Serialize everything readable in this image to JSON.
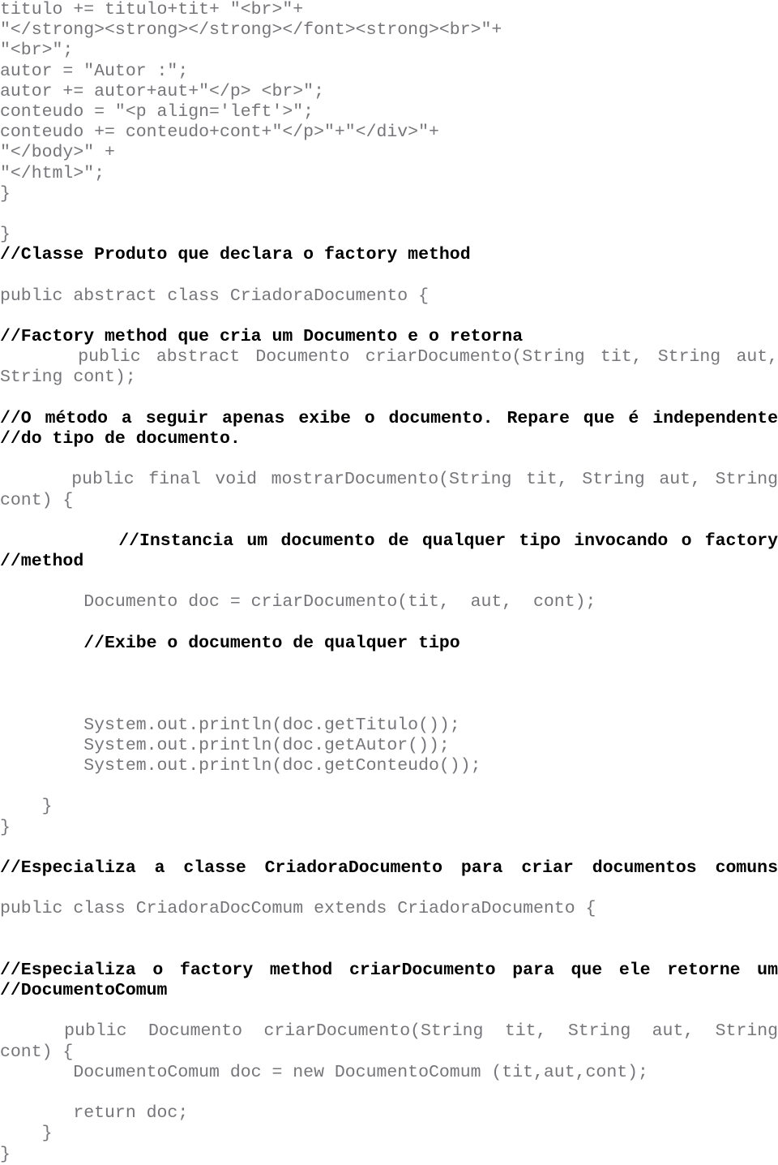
{
  "document": {
    "type": "source-code-listing",
    "language": "Java",
    "page_background": "#ffffff",
    "code_color": "#76767a",
    "comment_color": "#000000",
    "lines": [
      {
        "id": "l1",
        "text": "titulo += titulo+tit+ \"<br>\"+",
        "style": "code"
      },
      {
        "id": "l2",
        "text": "\"</strong><strong></strong></font><strong><br>\"+",
        "style": "code"
      },
      {
        "id": "l3",
        "text": "\"<br>\";",
        "style": "code"
      },
      {
        "id": "l4",
        "text": "autor = \"Autor :\";",
        "style": "code"
      },
      {
        "id": "l5",
        "text": "autor += autor+aut+\"</p> <br>\";",
        "style": "code"
      },
      {
        "id": "l6",
        "text": "conteudo = \"<p align='left'>\";",
        "style": "code"
      },
      {
        "id": "l7",
        "text": "conteudo += conteudo+cont+\"</p>\"+\"</div>\"+",
        "style": "code"
      },
      {
        "id": "l8",
        "text": "\"</body>\" +",
        "style": "code"
      },
      {
        "id": "l9",
        "text": "\"</html>\";",
        "style": "code"
      },
      {
        "id": "l10",
        "text": "}",
        "style": "code"
      },
      {
        "id": "l11",
        "text": "",
        "style": "blank"
      },
      {
        "id": "l12",
        "text": "}",
        "style": "code"
      },
      {
        "id": "l13",
        "text": "//Classe Produto que declara o factory method",
        "style": "comment"
      },
      {
        "id": "l14",
        "text": "",
        "style": "blank"
      },
      {
        "id": "l15",
        "text": "public abstract class CriadoraDocumento {",
        "style": "code"
      },
      {
        "id": "l16",
        "text": "",
        "style": "blank"
      },
      {
        "id": "l17",
        "text": "//Factory method que cria um Documento e o retorna",
        "style": "comment"
      },
      {
        "id": "l18",
        "text": "    public abstract Documento criarDocumento(String tit,  String aut,",
        "style": "code-justify"
      },
      {
        "id": "l19",
        "text": "String cont);",
        "style": "code"
      },
      {
        "id": "l20",
        "text": "",
        "style": "blank"
      },
      {
        "id": "l21",
        "text": "//O método a seguir apenas exibe o documento. Repare que é independente",
        "style": "comment-justify"
      },
      {
        "id": "l22",
        "text": "//do tipo de documento.",
        "style": "comment"
      },
      {
        "id": "l23",
        "text": "",
        "style": "blank"
      },
      {
        "id": "l24",
        "text": "    public final void mostrarDocumento(String tit,  String aut,  String",
        "style": "code-justify"
      },
      {
        "id": "l25",
        "text": "cont) {",
        "style": "code"
      },
      {
        "id": "l26",
        "text": "",
        "style": "blank"
      },
      {
        "id": "l27",
        "text": "        //Instancia um documento de qualquer tipo invocando o factory",
        "style": "comment-justify"
      },
      {
        "id": "l28",
        "text": "//method",
        "style": "comment"
      },
      {
        "id": "l29",
        "text": "",
        "style": "blank"
      },
      {
        "id": "l30",
        "text": "        Documento doc = criarDocumento(tit,  aut,  cont);",
        "style": "code"
      },
      {
        "id": "l31",
        "text": "",
        "style": "blank"
      },
      {
        "id": "l32",
        "text": "        //Exibe o documento de qualquer tipo",
        "style": "comment"
      },
      {
        "id": "l33",
        "text": "",
        "style": "blank"
      },
      {
        "id": "l34",
        "text": "",
        "style": "blank"
      },
      {
        "id": "l35",
        "text": "",
        "style": "blank"
      },
      {
        "id": "l36",
        "text": "        System.out.println(doc.getTitulo());",
        "style": "code"
      },
      {
        "id": "l37",
        "text": "        System.out.println(doc.getAutor());",
        "style": "code"
      },
      {
        "id": "l38",
        "text": "        System.out.println(doc.getConteudo());",
        "style": "code"
      },
      {
        "id": "l39",
        "text": "",
        "style": "blank"
      },
      {
        "id": "l40",
        "text": "    }",
        "style": "code"
      },
      {
        "id": "l41",
        "text": "}",
        "style": "code"
      },
      {
        "id": "l42",
        "text": "",
        "style": "blank"
      },
      {
        "id": "l43",
        "text": "//Especializa a classe CriadoraDocumento para criar documentos comuns",
        "style": "comment-justify"
      },
      {
        "id": "l44",
        "text": "",
        "style": "blank"
      },
      {
        "id": "l45",
        "text": "public class CriadoraDocComum extends CriadoraDocumento {",
        "style": "code"
      },
      {
        "id": "l46",
        "text": "",
        "style": "blank"
      },
      {
        "id": "l47",
        "text": "",
        "style": "blank"
      },
      {
        "id": "l48",
        "text": "//Especializa o factory method criarDocumento para que ele retorne um",
        "style": "comment-justify"
      },
      {
        "id": "l49",
        "text": "//DocumentoComum",
        "style": "comment"
      },
      {
        "id": "l50",
        "text": "",
        "style": "blank"
      },
      {
        "id": "l51",
        "text": "  public Documento criarDocumento(String tit,  String aut,  String",
        "style": "code-justify"
      },
      {
        "id": "l52",
        "text": "cont) {",
        "style": "code"
      },
      {
        "id": "l53",
        "text": "       DocumentoComum doc = new DocumentoComum (tit,aut,cont);",
        "style": "code"
      },
      {
        "id": "l54",
        "text": "",
        "style": "blank"
      },
      {
        "id": "l55",
        "text": "       return doc;",
        "style": "code"
      },
      {
        "id": "l56",
        "text": "    }",
        "style": "code"
      },
      {
        "id": "l57",
        "text": "}",
        "style": "code"
      }
    ]
  }
}
